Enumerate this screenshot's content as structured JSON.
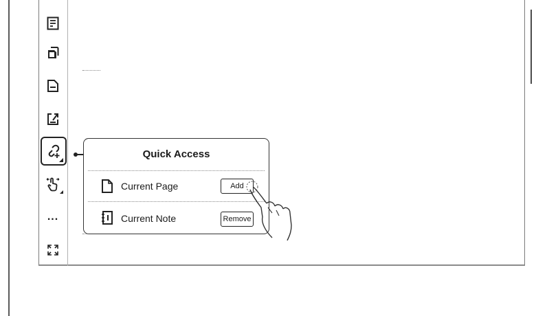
{
  "toolbar": {
    "items": [
      {
        "icon": "page-list-icon"
      },
      {
        "icon": "copy-pages-icon"
      },
      {
        "icon": "delete-page-icon"
      },
      {
        "icon": "export-icon"
      },
      {
        "icon": "link-add-icon",
        "active": true
      },
      {
        "icon": "touch-gesture-icon"
      },
      {
        "icon": "more-icon",
        "label": "..."
      },
      {
        "icon": "expand-icon"
      }
    ]
  },
  "quick_access": {
    "title": "Quick Access",
    "rows": [
      {
        "label": "Current Page",
        "button": "Add",
        "icon": "page-icon"
      },
      {
        "label": "Current Note",
        "button": "Remove",
        "icon": "notebook-icon"
      }
    ]
  },
  "colors": {
    "ink": "#1a1a1a",
    "border": "#333333",
    "background": "#ffffff"
  }
}
